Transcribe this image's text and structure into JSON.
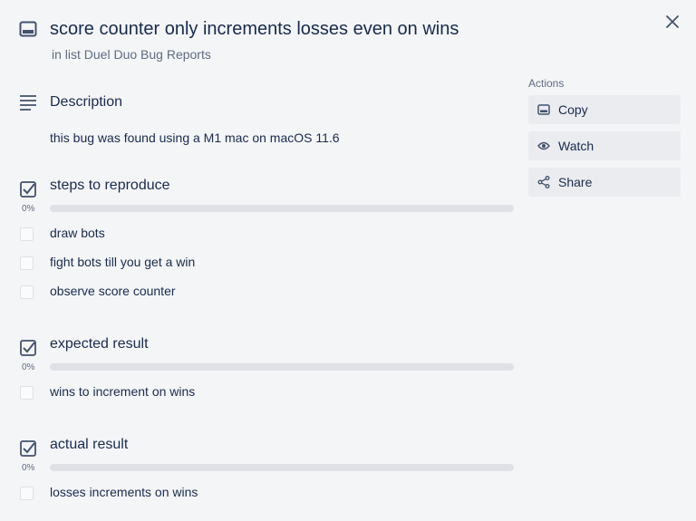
{
  "card": {
    "title": "score counter only increments losses even on wins",
    "list_label": "in list Duel Duo Bug Reports",
    "icon": "card-icon",
    "close_icon": "close-icon"
  },
  "description": {
    "heading": "Description",
    "text": "this bug was found using a M1 mac on macOS 11.6",
    "icon": "description-lines-icon"
  },
  "checklists": [
    {
      "title": "steps to reproduce",
      "percent_label": "0%",
      "progress": 0,
      "items": [
        {
          "text": "draw bots",
          "checked": false
        },
        {
          "text": "fight bots till you get a win",
          "checked": false
        },
        {
          "text": "observe score counter",
          "checked": false
        }
      ]
    },
    {
      "title": "expected result",
      "percent_label": "0%",
      "progress": 0,
      "items": [
        {
          "text": "wins to increment on wins",
          "checked": false
        }
      ]
    },
    {
      "title": "actual result",
      "percent_label": "0%",
      "progress": 0,
      "items": [
        {
          "text": "losses increments on wins",
          "checked": false
        }
      ]
    }
  ],
  "actions": {
    "label": "Actions",
    "copy": {
      "label": "Copy",
      "icon": "card-icon"
    },
    "watch": {
      "label": "Watch",
      "icon": "eye-icon"
    },
    "share": {
      "label": "Share",
      "icon": "share-icon"
    }
  },
  "colors": {
    "background": "#f4f5f7",
    "button": "#ebecf0",
    "progress_track": "#dfe1e6",
    "text": "#172b4d",
    "muted": "#5e6c84"
  }
}
